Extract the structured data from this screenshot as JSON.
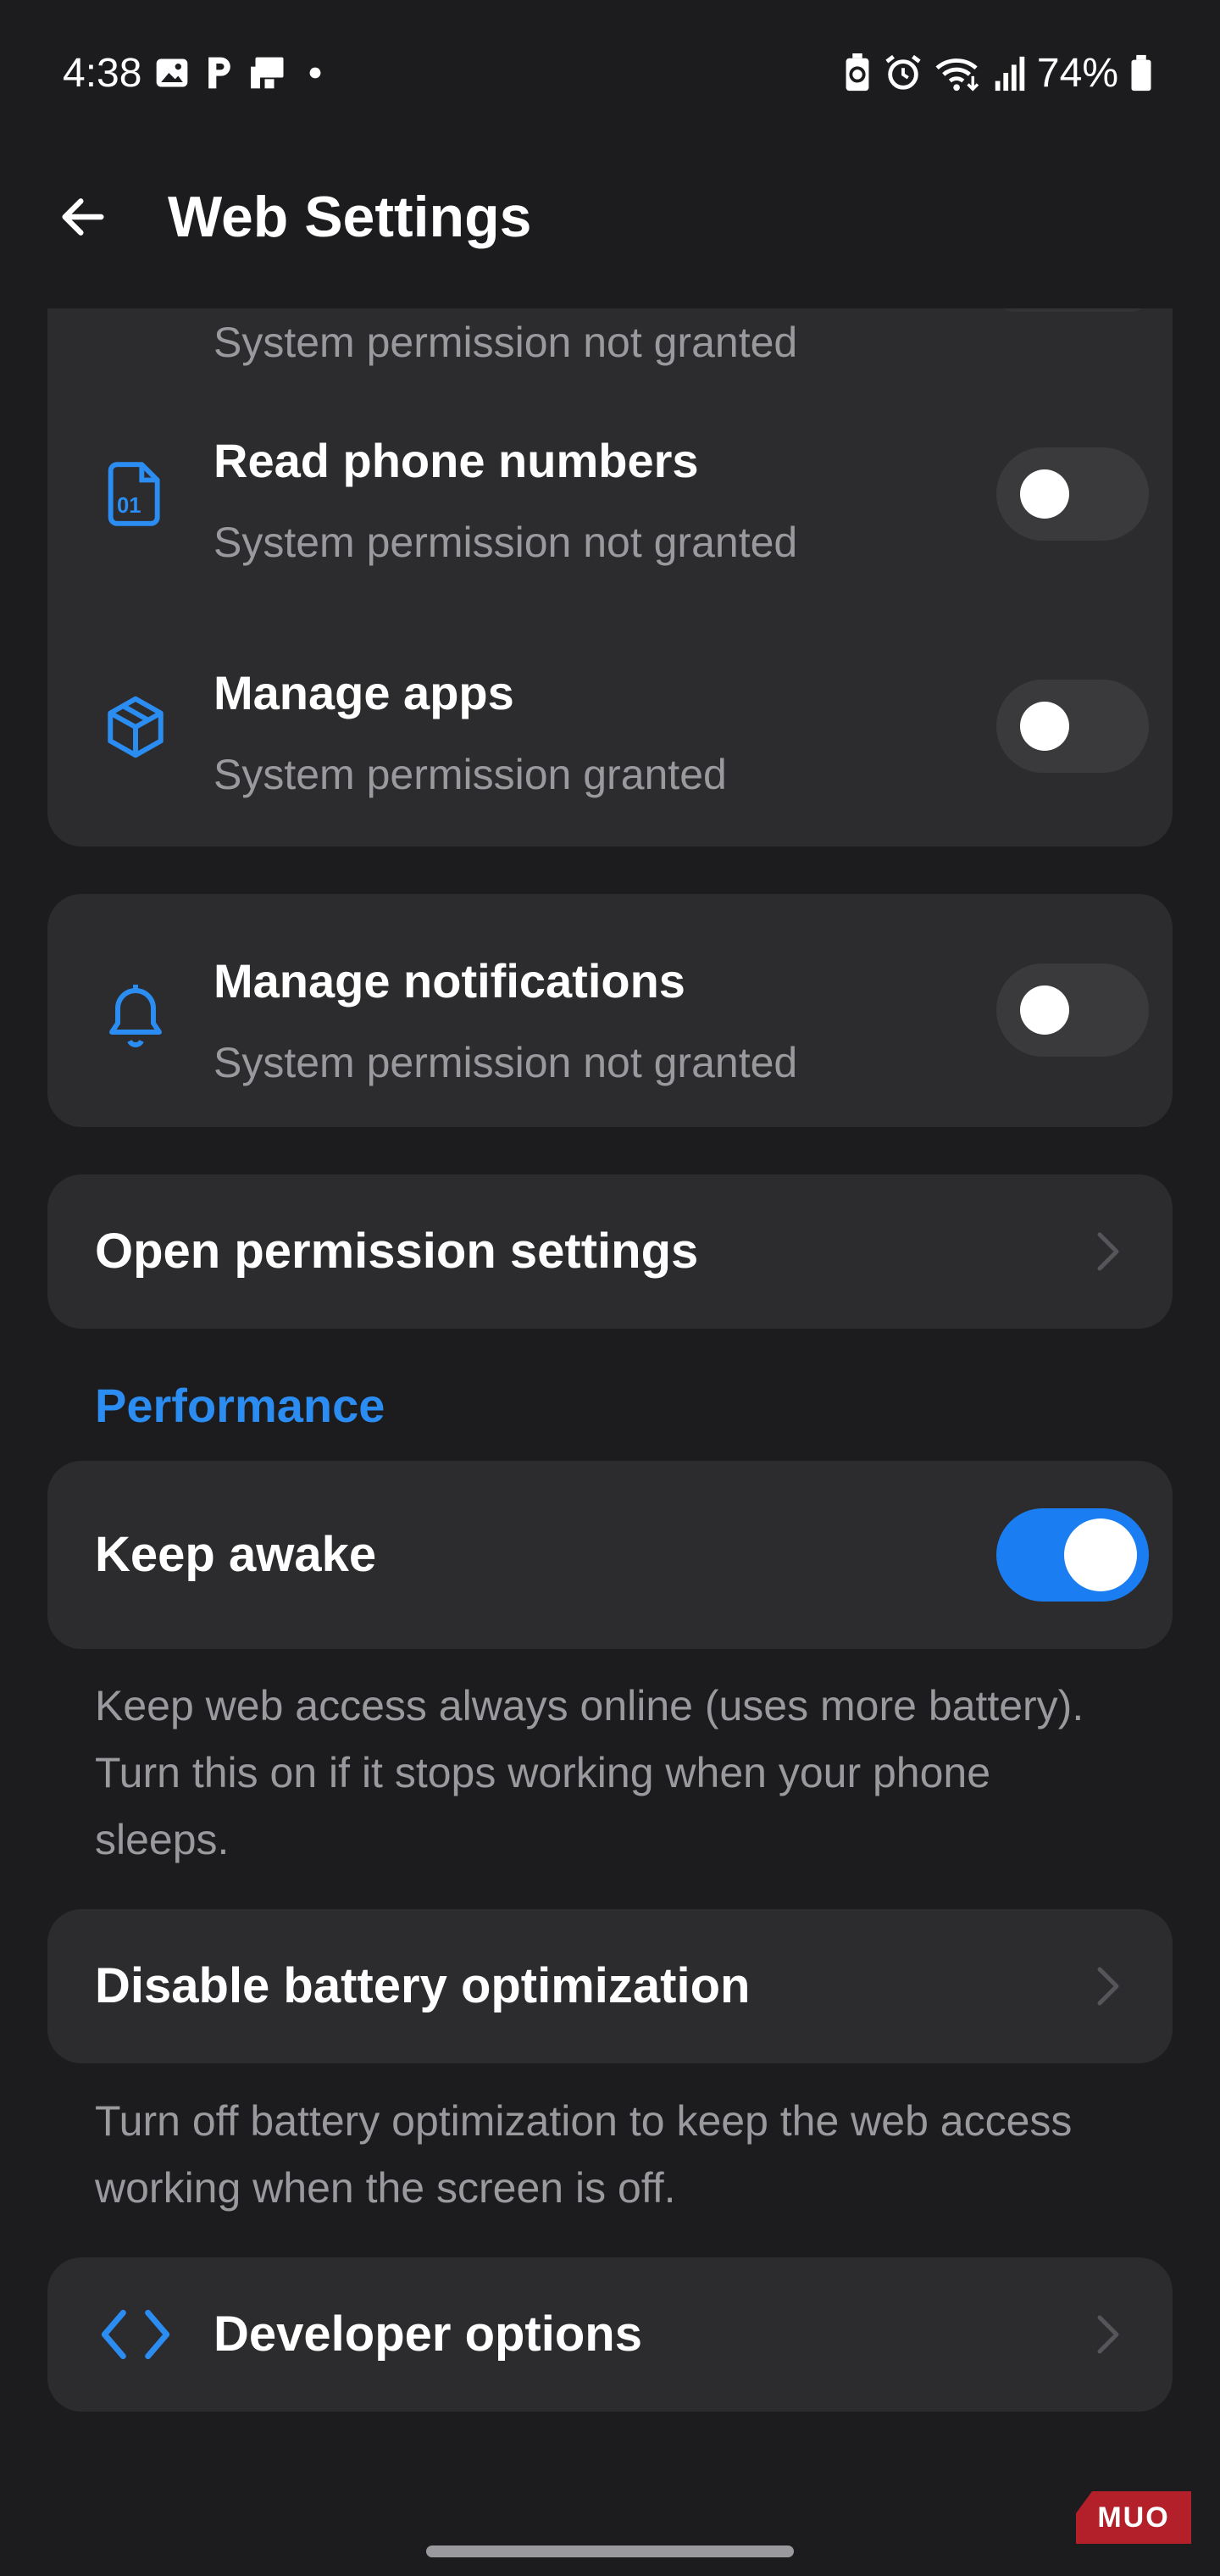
{
  "status_bar": {
    "time": "4:38",
    "battery": "74%",
    "icons": [
      "gallery-icon",
      "p-app-icon",
      "cast-icon",
      "dot-icon",
      "battery-saver-icon",
      "alarm-icon",
      "wifi-icon",
      "signal-icon",
      "battery-icon"
    ]
  },
  "app_bar": {
    "title": "Web Settings",
    "back_icon": "arrow-left-icon"
  },
  "permissions_card": {
    "clipped_subtitle": "System permission not granted",
    "items": [
      {
        "title": "Read phone numbers",
        "subtitle": "System permission not granted",
        "icon": "phone-number-icon",
        "enabled": false
      },
      {
        "title": "Manage apps",
        "subtitle": "System permission granted",
        "icon": "cube-icon",
        "enabled": false
      }
    ]
  },
  "notifications_card": {
    "title": "Manage notifications",
    "subtitle": "System permission not granted",
    "icon": "bell-icon",
    "enabled": false
  },
  "open_permission_settings": {
    "label": "Open permission settings"
  },
  "performance": {
    "header": "Performance",
    "keep_awake": {
      "label": "Keep awake",
      "enabled": true
    },
    "keep_awake_help": "Keep web access always online (uses more battery). Turn this on if it stops working when your phone sleeps.",
    "disable_battery": {
      "label": "Disable battery optimization"
    },
    "disable_battery_help": "Turn off battery optimization to keep the web access working when the screen is off."
  },
  "developer_options": {
    "label": "Developer options",
    "icon": "code-icon"
  },
  "watermark": "MUO",
  "colors": {
    "background": "#1c1c1e",
    "card": "#2c2c2e",
    "accent": "#1a7ef2",
    "secondary_text": "#9a9a9e"
  }
}
